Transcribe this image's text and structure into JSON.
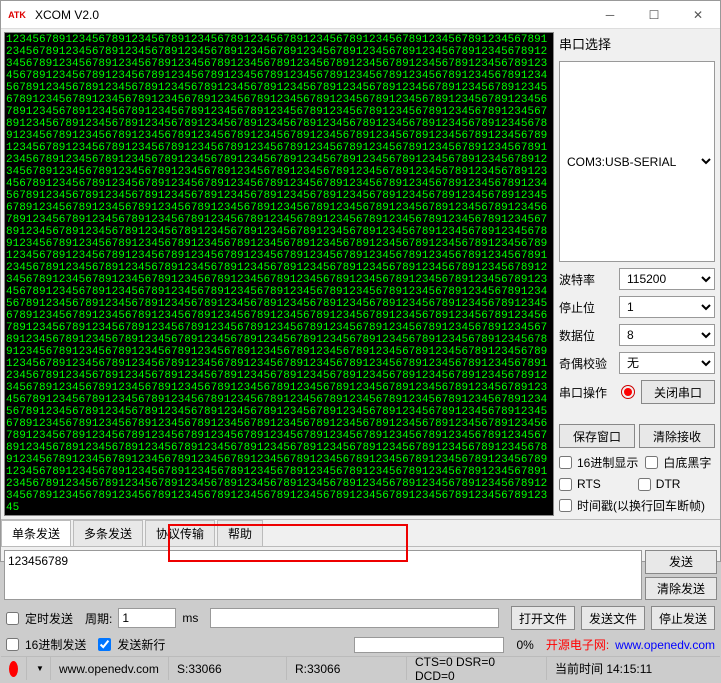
{
  "title": "XCOM V2.0",
  "app_icon": "ATK",
  "terminal_fill": "123456789",
  "terminal_chars": 3200,
  "side": {
    "port_select_label": "串口选择",
    "port_value": "COM3:USB-SERIAL",
    "baud_label": "波特率",
    "baud_value": "115200",
    "stop_label": "停止位",
    "stop_value": "1",
    "data_label": "数据位",
    "data_value": "8",
    "parity_label": "奇偶校验",
    "parity_value": "无",
    "op_label": "串口操作",
    "close_btn": "关闭串口",
    "save_btn": "保存窗口",
    "clear_btn": "清除接收",
    "hex_disp": "16进制显示",
    "white_black": "白底黑字",
    "rts": "RTS",
    "dtr": "DTR",
    "timestamp": "时间戳(以换行回车断帧)"
  },
  "tabs": {
    "single": "单条发送",
    "multi": "多条发送",
    "protocol": "协议传输",
    "help": "帮助"
  },
  "send_text": "123456789",
  "send_btn": "发送",
  "clear_send_btn": "清除发送",
  "timed_send": "定时发送",
  "period_label": "周期:",
  "period_value": "1",
  "period_unit": "ms",
  "open_file": "打开文件",
  "send_file": "发送文件",
  "stop_send": "停止发送",
  "hex_send": "16进制发送",
  "send_newline": "发送新行",
  "percent": "0%",
  "link_label": "开源电子网:",
  "link_url": "www.openedv.com",
  "status": {
    "url": "www.openedv.com",
    "s": "S:33066",
    "r": "R:33066",
    "cts": "CTS=0 DSR=0 DCD=0",
    "time_label": "当前时间 14:15:11"
  }
}
